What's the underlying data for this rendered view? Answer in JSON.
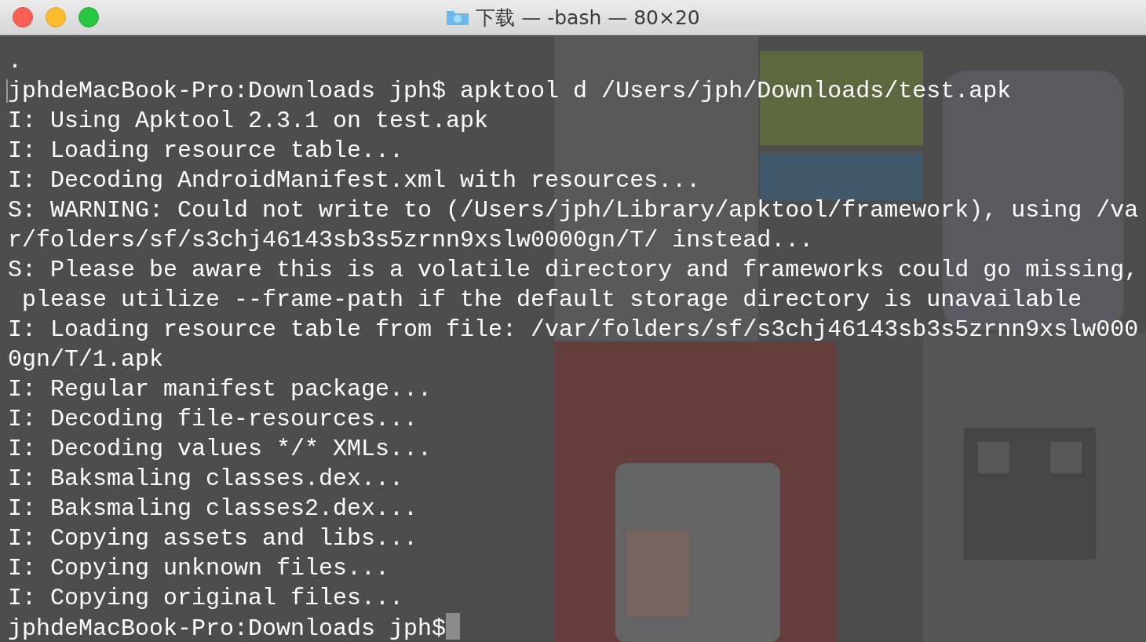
{
  "window": {
    "title": "下载 — -bash — 80×20"
  },
  "terminal": {
    "rows": [
      {
        "text": ".",
        "marked": false
      },
      {
        "text": "jphdeMacBook-Pro:Downloads jph$ apktool d /Users/jph/Downloads/test.apk",
        "marked": true
      },
      {
        "text": "I: Using Apktool 2.3.1 on test.apk",
        "marked": false
      },
      {
        "text": "I: Loading resource table...",
        "marked": false
      },
      {
        "text": "I: Decoding AndroidManifest.xml with resources...",
        "marked": false
      },
      {
        "text": "S: WARNING: Could not write to (/Users/jph/Library/apktool/framework), using /va",
        "marked": false
      },
      {
        "text": "r/folders/sf/s3chj46143sb3s5zrnn9xslw0000gn/T/ instead...",
        "marked": false
      },
      {
        "text": "S: Please be aware this is a volatile directory and frameworks could go missing,",
        "marked": false
      },
      {
        "text": " please utilize --frame-path if the default storage directory is unavailable",
        "marked": false
      },
      {
        "text": "I: Loading resource table from file: /var/folders/sf/s3chj46143sb3s5zrnn9xslw000",
        "marked": false
      },
      {
        "text": "0gn/T/1.apk",
        "marked": false
      },
      {
        "text": "I: Regular manifest package...",
        "marked": false
      },
      {
        "text": "I: Decoding file-resources...",
        "marked": false
      },
      {
        "text": "I: Decoding values */* XMLs...",
        "marked": false
      },
      {
        "text": "I: Baksmaling classes.dex...",
        "marked": false
      },
      {
        "text": "I: Baksmaling classes2.dex...",
        "marked": false
      },
      {
        "text": "I: Copying assets and libs...",
        "marked": false
      },
      {
        "text": "I: Copying unknown files...",
        "marked": false
      },
      {
        "text": "I: Copying original files...",
        "marked": false
      }
    ],
    "prompt": "jphdeMacBook-Pro:Downloads jph$",
    "cursor": true
  }
}
